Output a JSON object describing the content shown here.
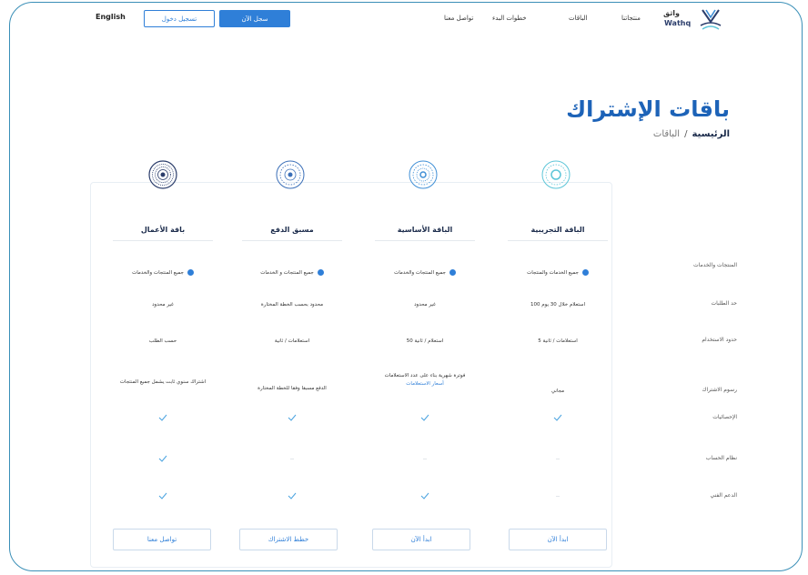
{
  "header": {
    "language": "English",
    "login": "تسجيل دخول",
    "register": "سجل الآن",
    "nav": [
      "تواصل معنا",
      "خطوات البدء",
      "الباقات",
      "منتجاتنا"
    ],
    "logo_ar": "واثق",
    "logo_en": "Wathq"
  },
  "page": {
    "title": "باقات الإشتراك",
    "breadcrumb_home": "الرئيسية",
    "breadcrumb_sep": "/",
    "breadcrumb_current": "الباقات"
  },
  "row_labels": [
    "المنتجات والخدمات",
    "حد الطلبات",
    "حدود الاستخدام",
    "رسوم الاشتراك",
    "الإحصائيات",
    "نظام الحساب",
    "الدعم الفني"
  ],
  "plans": [
    {
      "name": "الباقة التجريبية",
      "services": "جميع الخدمات والمنتجات",
      "limit": "100 استعلام خلال 30 يوم",
      "usage": "5 استعلامات / ثانية",
      "fee": "مجاني",
      "fee_link": "",
      "stats": true,
      "account": false,
      "support": false,
      "button": "ابدأ الآن",
      "icon_color": "#5cc5d8"
    },
    {
      "name": "الباقة الأساسية",
      "services": "جميع المنتجات والخدمات",
      "limit": "غير محدود",
      "usage": "50 استعلام / ثانية",
      "fee": "فوترة شهرية بناء على عدد الاستعلامات",
      "fee_link": "أسعار الاستعلامات",
      "stats": true,
      "account": false,
      "support": true,
      "button": "ابدأ الآن",
      "icon_color": "#3f8fd6"
    },
    {
      "name": "مسبق الدفع",
      "services": "جميع المنتجات و الخدمات",
      "limit": "محدود بحسب الخطة المختارة",
      "usage": "استعلامات / ثانية",
      "fee": "الدفع مسبقا وفقا للخطة المختارة",
      "fee_link": "",
      "stats": true,
      "account": false,
      "support": true,
      "button": "خطط الاشتراك",
      "icon_color": "#3b6fb8"
    },
    {
      "name": "باقة الأعمال",
      "services": "جميع المنتجات والخدمات",
      "limit": "غير محدود",
      "usage": "حسب الطلب",
      "fee": "اشتراك سنوي ثابت يشمل جميع المنتجات",
      "fee_link": "",
      "stats": true,
      "account": true,
      "support": true,
      "button": "تواصل معنا",
      "icon_color": "#2b3d6b"
    }
  ],
  "colors": {
    "accent": "#2f7fd8",
    "title": "#1d63b8",
    "check": "#4aa3e0",
    "frame": "#3a8fb7"
  }
}
